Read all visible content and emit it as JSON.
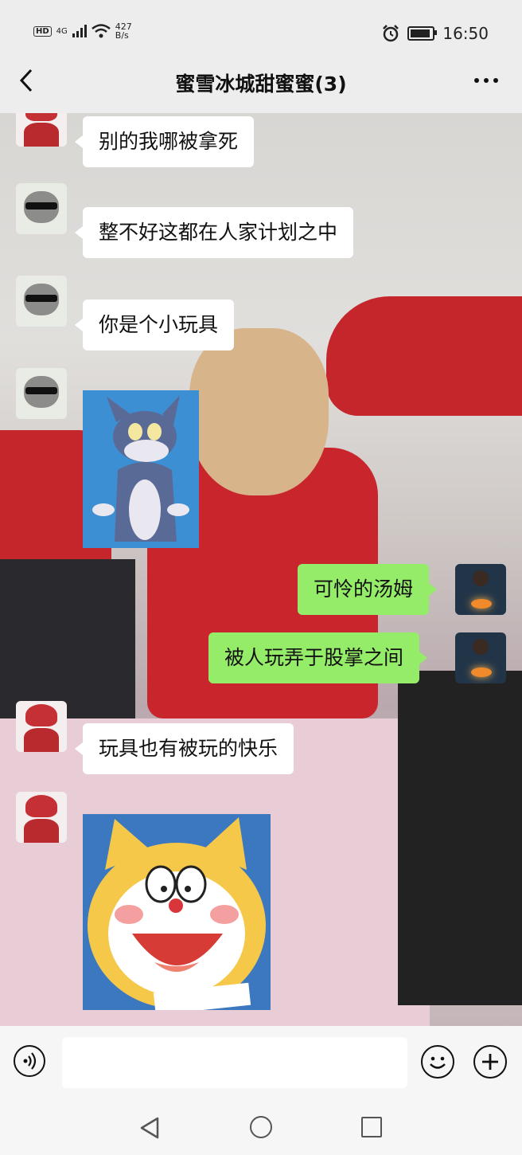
{
  "status_bar": {
    "hd": "HD",
    "network": "4G",
    "speed_value": "427",
    "speed_unit": "B/s",
    "time": "16:50",
    "battery_level": 0.8
  },
  "header": {
    "title": "蜜雪冰城甜蜜蜜(3)"
  },
  "messages": [
    {
      "side": "in",
      "avatar": "red-hair-avatar",
      "text": "别的我哪被拿死"
    },
    {
      "side": "in",
      "avatar": "raccoon-sunglasses-avatar",
      "text": "整不好这都在人家计划之中"
    },
    {
      "side": "in",
      "avatar": "raccoon-sunglasses-avatar",
      "text": "你是个小玩具"
    },
    {
      "side": "in",
      "avatar": "raccoon-sunglasses-avatar",
      "sticker": "tom-cat-sticker"
    },
    {
      "side": "out",
      "avatar": "boy-campfire-avatar",
      "text": "可怜的汤姆"
    },
    {
      "side": "out",
      "avatar": "boy-campfire-avatar",
      "text": "被人玩弄于股掌之间"
    },
    {
      "side": "in",
      "avatar": "red-hair-avatar",
      "text": "玩具也有被玩的快乐"
    },
    {
      "side": "in",
      "avatar": "red-hair-avatar",
      "sticker": "doraemon-yellow-sticker"
    }
  ],
  "input_bar": {
    "input_value": "",
    "icons": [
      "voice-icon",
      "emoji-icon",
      "plus-icon"
    ]
  },
  "nav_bar": {
    "icons": [
      "nav-back-icon",
      "nav-home-icon",
      "nav-recents-icon"
    ]
  }
}
